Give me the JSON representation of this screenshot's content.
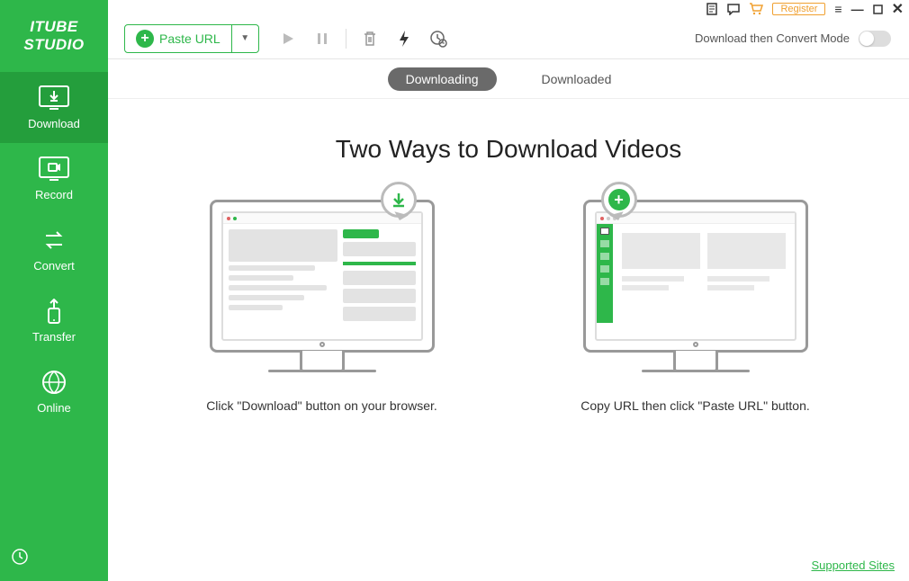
{
  "app": {
    "title": "ITUBE STUDIO"
  },
  "sidebar": {
    "items": [
      {
        "label": "Download"
      },
      {
        "label": "Record"
      },
      {
        "label": "Convert"
      },
      {
        "label": "Transfer"
      },
      {
        "label": "Online"
      }
    ]
  },
  "titlebar": {
    "register": "Register"
  },
  "toolbar": {
    "paste_url": "Paste URL",
    "convert_mode_label": "Download then Convert Mode"
  },
  "tabs": {
    "downloading": "Downloading",
    "downloaded": "Downloaded"
  },
  "content": {
    "headline": "Two Ways to Download Videos",
    "method1_caption": "Click \"Download\" button on your browser.",
    "method2_caption": "Copy URL then click \"Paste URL\" button."
  },
  "footer": {
    "supported_sites": "Supported Sites"
  }
}
